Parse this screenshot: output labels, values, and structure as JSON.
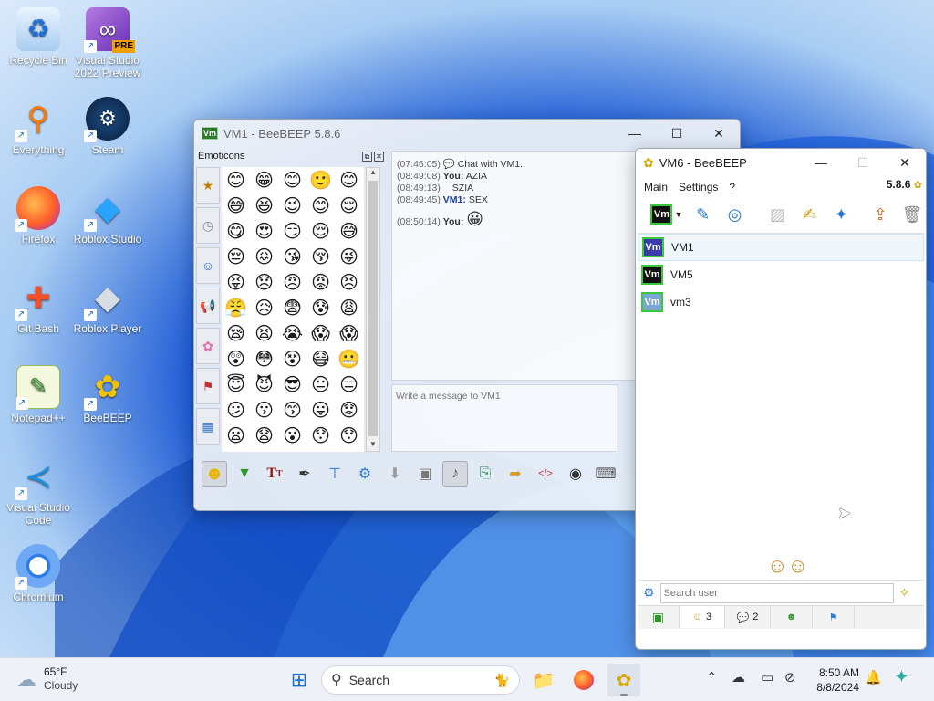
{
  "desktop": {
    "icons": [
      {
        "label": "Recycle Bin"
      },
      {
        "label": "Visual Studio 2022 Preview",
        "badge": "PRE"
      },
      {
        "label": "Everything"
      },
      {
        "label": "Steam"
      },
      {
        "label": "Firefox"
      },
      {
        "label": "Roblox Studio"
      },
      {
        "label": "Git Bash"
      },
      {
        "label": "Roblox Player"
      },
      {
        "label": "Notepad++"
      },
      {
        "label": "BeeBEEP"
      },
      {
        "label": "Visual Studio Code"
      },
      {
        "label": "Chromium"
      }
    ]
  },
  "vm1_window": {
    "badge": "Vm",
    "title": "VM1 - BeeBEEP 5.8.6",
    "emoticons_label": "Emoticons",
    "emoticons": [
      "😊",
      "😁",
      "😊",
      "🙂",
      "😊",
      "😅",
      "😆",
      "😉",
      "😊",
      "😌",
      "😋",
      "😍",
      "😏",
      "😌",
      "😅",
      "😔",
      "😖",
      "😘",
      "😚",
      "😜",
      "😝",
      "😞",
      "😠",
      "😡",
      "😣",
      "😤",
      "😥",
      "😨",
      "😰",
      "😩",
      "😪",
      "😫",
      "😭",
      "😱",
      "😱",
      "😲",
      "😳",
      "😵",
      "😷",
      "😬",
      "😇",
      "😈",
      "😎",
      "😐",
      "😑",
      "😕",
      "😗",
      "😙",
      "😛",
      "😟",
      "😦",
      "😧",
      "😮",
      "😯",
      "😯"
    ],
    "chat": [
      {
        "time": "(07:46:05)",
        "text": "Chat with VM1."
      },
      {
        "time": "(08:49:08)",
        "who": "You:",
        "text": "AZIA"
      },
      {
        "time": "(08:49:13)",
        "text": "SZIA"
      },
      {
        "time": "(08:49:45)",
        "who": "VM1:",
        "text": "SEX"
      },
      {
        "time": "(08:50:14)",
        "who": "You:",
        "text": "😀"
      }
    ],
    "input_placeholder": "Write a message to VM1"
  },
  "vm6_window": {
    "title": "VM6 - BeeBEEP",
    "menu": [
      "Main",
      "Settings",
      "?"
    ],
    "version": "5.8.6",
    "users": [
      {
        "name": "VM1",
        "badge": "Vm",
        "color": "#3b3ba8"
      },
      {
        "name": "VM5",
        "badge": "Vm",
        "color": "#111111"
      },
      {
        "name": "vm3",
        "badge": "Vm",
        "color": "#7aa7d8"
      }
    ],
    "search_placeholder": "Search user",
    "tabs": [
      {
        "label": ""
      },
      {
        "label": "3"
      },
      {
        "label": "2"
      },
      {
        "label": ""
      },
      {
        "label": ""
      }
    ]
  },
  "taskbar": {
    "temperature": "65°F",
    "condition": "Cloudy",
    "search_label": "Search",
    "time": "8:50 AM",
    "date": "8/8/2024"
  },
  "colors": {
    "accent": "#1e6fd9",
    "vm_green": "#38c938"
  }
}
